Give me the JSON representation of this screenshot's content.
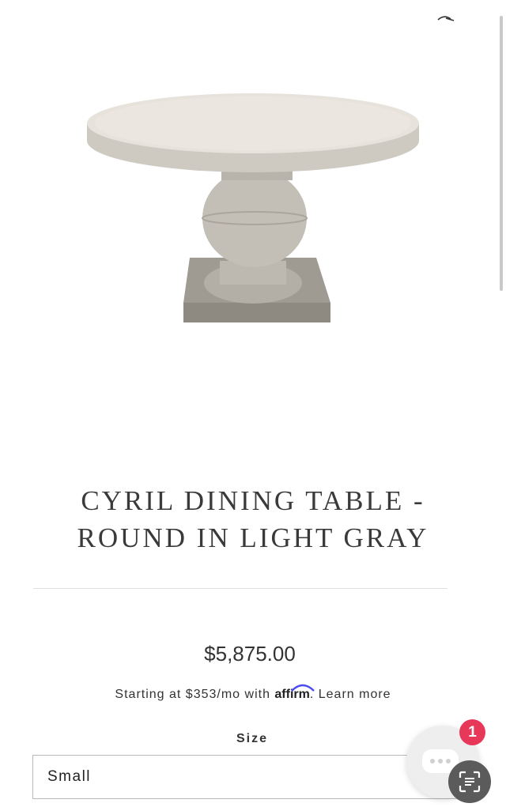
{
  "product": {
    "title_line1": "CYRIL DINING TABLE -",
    "title_line2": "ROUND IN LIGHT GRAY",
    "image_icon": "product-photo",
    "price": "$5,875.00"
  },
  "financing": {
    "prefix": "Starting at $353/mo with ",
    "provider": "affirm",
    "suffix": ". ",
    "link": "Learn more"
  },
  "size": {
    "label": "Size",
    "selected": "Small"
  },
  "chat": {
    "badge_count": "1",
    "icon": "chat-bubble-icon"
  },
  "scan": {
    "icon": "scan-text-icon"
  },
  "colors": {
    "badge": "#e8385a",
    "affirm_arc": "#4a4af4"
  }
}
